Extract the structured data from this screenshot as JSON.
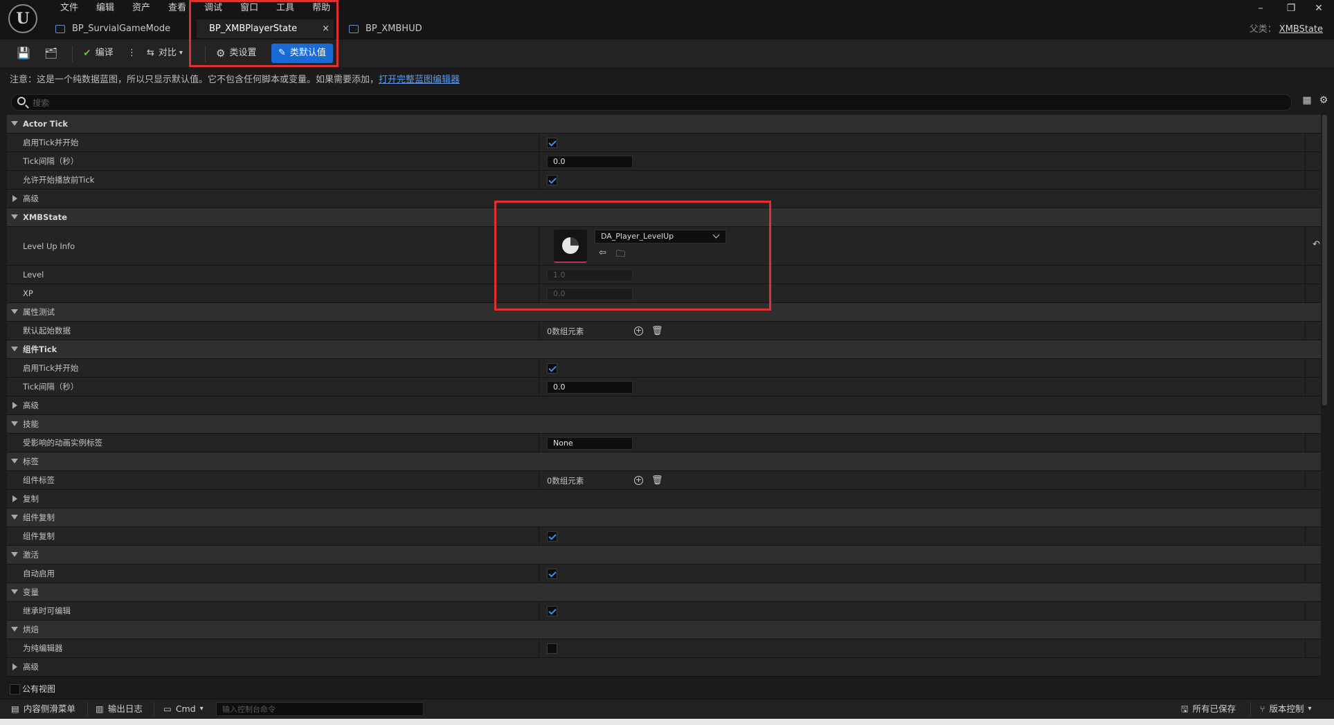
{
  "menu": [
    "文件",
    "编辑",
    "资产",
    "查看",
    "调试",
    "窗口",
    "工具",
    "帮助"
  ],
  "tabs": {
    "t1": "BP_SurvialGameMode",
    "t2": "BP_XMBPlayerState",
    "t3": "BP_XMBHUD",
    "close": "×"
  },
  "parent": {
    "label": "父类：",
    "value": "XMBState"
  },
  "toolbar": {
    "compile": "编译",
    "diff": "对比",
    "class_settings": "类设置",
    "class_defaults": "类默认值"
  },
  "notice": {
    "text": "注意：这是一个纯数据蓝图，所以只显示默认值。它不包含任何脚本或变量。如果需要添加，",
    "link": "打开完整蓝图编辑器"
  },
  "search": {
    "placeholder": "搜索"
  },
  "rows": {
    "r0": "Actor Tick",
    "r1": "启用Tick并开始",
    "r2": "Tick间隔（秒）",
    "r3": "允许开始播放前Tick",
    "r4": "高级",
    "r5": "XMBState",
    "r6": "Level Up Info",
    "r7": "Level",
    "r8": "XP",
    "r9": "属性测试",
    "r10": "默认起始数据",
    "r11": "组件Tick",
    "r12": "启用Tick并开始",
    "r13": "Tick间隔（秒）",
    "r14": "高级",
    "r15": "技能",
    "r16": "受影响的动画实例标签",
    "r17": "标签",
    "r18": "组件标签",
    "r19": "复制",
    "r20": "组件复制",
    "r21": "组件复制",
    "r22": "激活",
    "r23": "自动启用",
    "r24": "变量",
    "r25": "继承时可编辑",
    "r26": "烘焙",
    "r27": "为纯编辑器",
    "r28": "高级"
  },
  "values": {
    "tick_interval": "0.0",
    "asset": "DA_Player_LevelUp",
    "level": "1.0",
    "xp": "0.0",
    "array_empty": "0数组元素",
    "comp_tick_interval": "0.0",
    "anim_tag": "None"
  },
  "public_view": "公有视图",
  "status": {
    "content_drawer": "内容侧滑菜单",
    "output_log": "输出日志",
    "cmd": "Cmd",
    "cmd_placeholder": "输入控制台命令",
    "all_saved": "所有已保存",
    "source_control": "版本控制"
  }
}
